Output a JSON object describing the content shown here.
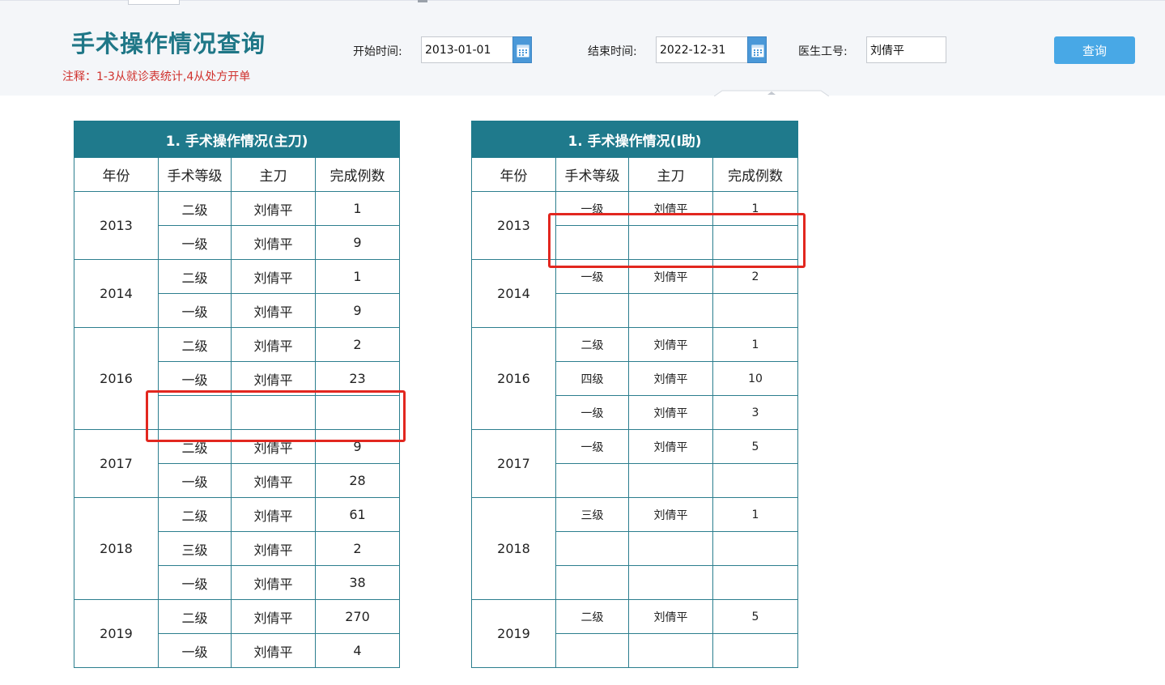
{
  "header": {
    "title": "手术操作情况查询",
    "note": "注释：1-3从就诊表统计,4从处方开单"
  },
  "filters": {
    "start_label": "开始时间:",
    "start_value": "2013-01-01",
    "end_label": "结束时间:",
    "end_value": "2022-12-31",
    "doctor_label": "医生工号:",
    "doctor_value": "刘倩平",
    "search_label": "查询"
  },
  "colors": {
    "accent": "#1f7a8c",
    "button": "#48a8e6",
    "note": "#d0312d",
    "highlight": "#e2271f"
  },
  "columns": [
    "年份",
    "手术等级",
    "主刀",
    "完成例数"
  ],
  "table_main": {
    "title": "1. 手术操作情况(主刀)",
    "groups": [
      {
        "year": "2013",
        "rows": [
          [
            "二级",
            "刘倩平",
            "1"
          ],
          [
            "一级",
            "刘倩平",
            "9"
          ]
        ]
      },
      {
        "year": "2014",
        "rows": [
          [
            "二级",
            "刘倩平",
            "1"
          ],
          [
            "一级",
            "刘倩平",
            "9"
          ]
        ]
      },
      {
        "year": "2016",
        "rows": [
          [
            "二级",
            "刘倩平",
            "2"
          ],
          [
            "一级",
            "刘倩平",
            "23"
          ],
          [
            "",
            "",
            ""
          ]
        ]
      },
      {
        "year": "2017",
        "rows": [
          [
            "二级",
            "刘倩平",
            "9"
          ],
          [
            "一级",
            "刘倩平",
            "28"
          ]
        ]
      },
      {
        "year": "2018",
        "rows": [
          [
            "二级",
            "刘倩平",
            "61"
          ],
          [
            "三级",
            "刘倩平",
            "2"
          ],
          [
            "一级",
            "刘倩平",
            "38"
          ]
        ]
      },
      {
        "year": "2019",
        "rows": [
          [
            "二级",
            "刘倩平",
            "270"
          ],
          [
            "一级",
            "刘倩平",
            "4"
          ]
        ]
      }
    ]
  },
  "table_assist": {
    "title": "1. 手术操作情况(I助)",
    "groups": [
      {
        "year": "2013",
        "rows": [
          [
            "一级",
            "刘倩平",
            "1"
          ],
          [
            "",
            "",
            ""
          ]
        ]
      },
      {
        "year": "2014",
        "rows": [
          [
            "一级",
            "刘倩平",
            "2"
          ],
          [
            "",
            "",
            ""
          ]
        ]
      },
      {
        "year": "2016",
        "rows": [
          [
            "二级",
            "刘倩平",
            "1"
          ],
          [
            "四级",
            "刘倩平",
            "10"
          ],
          [
            "一级",
            "刘倩平",
            "3"
          ]
        ]
      },
      {
        "year": "2017",
        "rows": [
          [
            "一级",
            "刘倩平",
            "5"
          ],
          [
            "",
            "",
            ""
          ]
        ]
      },
      {
        "year": "2018",
        "rows": [
          [
            "三级",
            "刘倩平",
            "1"
          ],
          [
            "",
            "",
            ""
          ],
          [
            "",
            "",
            ""
          ]
        ]
      },
      {
        "year": "2019",
        "rows": [
          [
            "二级",
            "刘倩平",
            "5"
          ],
          [
            "",
            "",
            ""
          ]
        ]
      }
    ]
  }
}
